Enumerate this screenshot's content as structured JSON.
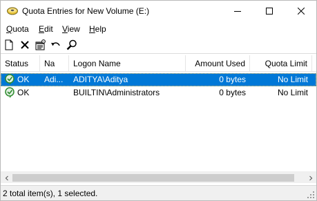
{
  "window": {
    "title": "Quota Entries for New Volume (E:)",
    "icon": "drive-quota-icon"
  },
  "menu": {
    "items": [
      {
        "label_acc": "Q",
        "label_rest": "uota"
      },
      {
        "label_acc": "E",
        "label_rest": "dit"
      },
      {
        "label_acc": "V",
        "label_rest": "iew"
      },
      {
        "label_acc": "H",
        "label_rest": "elp"
      }
    ]
  },
  "toolbar": {
    "buttons": [
      "new-quota-entry-icon",
      "delete-icon",
      "properties-icon",
      "undo-icon",
      "find-icon"
    ]
  },
  "list": {
    "columns": [
      "Status",
      "Na",
      "Logon Name",
      "Amount Used",
      "Quota Limit"
    ],
    "rows": [
      {
        "status": "OK",
        "name": "Adi...",
        "logon": "ADITYA\\Aditya",
        "used": "0 bytes",
        "limit": "No Limit",
        "selected": true
      },
      {
        "status": "OK",
        "name": "",
        "logon": "BUILTIN\\Administrators",
        "used": "0 bytes",
        "limit": "No Limit",
        "selected": false
      }
    ]
  },
  "statusbar": {
    "text": "2 total item(s), 1 selected."
  },
  "colors": {
    "selection": "#0078d7",
    "status_ok": "#2e8b2e"
  }
}
